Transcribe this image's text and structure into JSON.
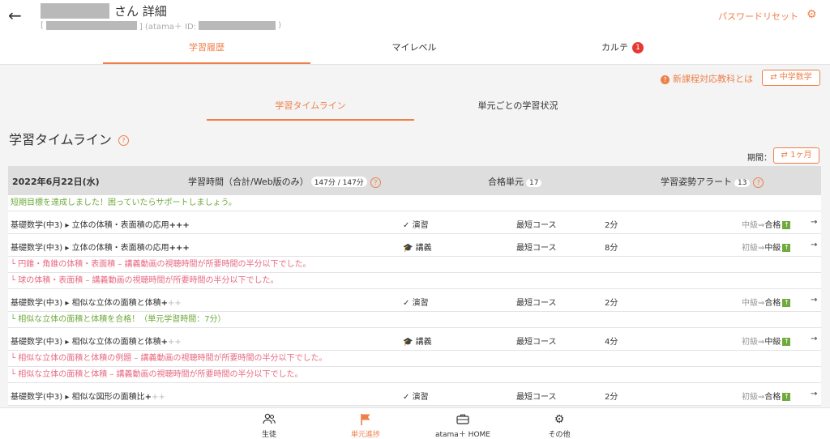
{
  "header": {
    "back_icon": "arrow-left-icon",
    "name_suffix": "さん 詳細",
    "id_open": "[",
    "id_label": "] (atama＋ ID:",
    "id_close": ")",
    "password_reset": "パスワードリセット",
    "settings_icon": "gear-icon"
  },
  "tabs": [
    {
      "label": "学習履歴"
    },
    {
      "label": "マイレベル"
    },
    {
      "label": "カルテ",
      "badge": "1"
    }
  ],
  "new_curriculum": {
    "icon": "?",
    "label": "新課程対応教科とは"
  },
  "subject_button": {
    "icon": "⇄",
    "label": "中学数学"
  },
  "subtabs": [
    {
      "label": "学習タイムライン"
    },
    {
      "label": "単元ごとの学習状況"
    }
  ],
  "section": {
    "title": "学習タイムライン",
    "help_icon": "?"
  },
  "period": {
    "label": "期間：",
    "button_icon": "⇄",
    "button_label": "1ヶ月"
  },
  "day": {
    "date": "2022年6月22日(水)",
    "study_time_label": "学習時間（合計/Web版のみ）",
    "study_time_value": "147分 / 147分",
    "passed_label": "合格単元",
    "passed_value": "17",
    "alert_label": "学習姿勢アラート",
    "alert_value": "13",
    "help_icon": "?"
  },
  "goal_notice": "短期目標を達成しました！困っていたらサポートしましょう。",
  "rows": [
    {
      "course": "基礎数学(中3)",
      "arrow": "▸",
      "title": "立体の体積・表面積の応用",
      "plus_on": "+++",
      "plus_off": "",
      "type_icon": "✓",
      "type": "演習",
      "route": "最短コース",
      "time": "2分",
      "from": "中級",
      "to": "合格",
      "up": "↑",
      "go": "→"
    },
    {
      "course": "基礎数学(中3)",
      "arrow": "▸",
      "title": "立体の体積・表面積の応用",
      "plus_on": "+++",
      "plus_off": "",
      "type_icon": "🎓",
      "type": "講義",
      "route": "最短コース",
      "time": "8分",
      "from": "初級",
      "to": "中級",
      "up": "↑",
      "go": "→"
    },
    {
      "course": "基礎数学(中3)",
      "arrow": "▸",
      "title": "相似な立体の面積と体積",
      "plus_on": "+",
      "plus_off": "++",
      "type_icon": "✓",
      "type": "演習",
      "route": "最短コース",
      "time": "2分",
      "from": "中級",
      "to": "合格",
      "up": "↑",
      "go": "→"
    },
    {
      "course": "基礎数学(中3)",
      "arrow": "▸",
      "title": "相似な立体の面積と体積",
      "plus_on": "+",
      "plus_off": "++",
      "type_icon": "🎓",
      "type": "講義",
      "route": "最短コース",
      "time": "4分",
      "from": "初級",
      "to": "中級",
      "up": "↑",
      "go": "→"
    },
    {
      "course": "基礎数学(中3)",
      "arrow": "▸",
      "title": "相似な図形の面積比",
      "plus_on": "+",
      "plus_off": "++",
      "type_icon": "✓",
      "type": "演習",
      "route": "最短コース",
      "time": "2分",
      "from": "初級",
      "to": "合格",
      "up": "↑",
      "go": "→"
    }
  ],
  "notes_row2": [
    "└ 円錐・角錐の体積・表面積 – 講義動画の視聴時間が所要時間の半分以下でした。",
    "└ 球の体積・表面積 – 講義動画の視聴時間が所要時間の半分以下でした。"
  ],
  "note_row3": "└ 相似な立体の面積と体積を合格！（単元学習時間：7分）",
  "notes_row4": [
    "└ 相似な立体の面積と体積の例題 – 講義動画の視聴時間が所要時間の半分以下でした。",
    "└ 相似な立体の面積と体積 – 講義動画の視聴時間が所要時間の半分以下でした。"
  ],
  "bottom_nav": [
    {
      "icon": "users-icon",
      "label": "生徒"
    },
    {
      "icon": "flag-icon",
      "label": "単元進捗"
    },
    {
      "icon": "briefcase-icon",
      "label": "atama＋ HOME"
    },
    {
      "icon": "gear-icon",
      "label": "その他"
    }
  ],
  "colors": {
    "accent": "#ef7f4a",
    "success": "#6eaa3c",
    "warning": "#e86a82",
    "badge": "#e53935"
  }
}
